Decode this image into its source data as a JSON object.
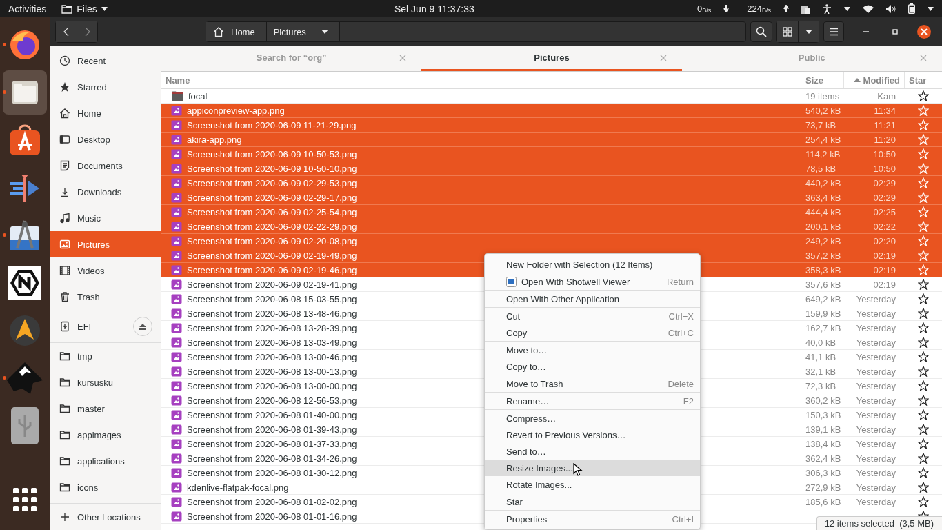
{
  "top_bar": {
    "activities": "Activities",
    "app_menu": "Files",
    "clock": "Sel Jun 9  11:37:33",
    "net_down": "0$_{B/s}$",
    "net_up": "224$_{B/s}$"
  },
  "dock": [
    {
      "kind": "browser",
      "running": true,
      "selected": false
    },
    {
      "kind": "files",
      "running": true,
      "selected": true
    },
    {
      "kind": "store",
      "running": false,
      "selected": false
    },
    {
      "kind": "video",
      "running": false,
      "selected": false
    },
    {
      "kind": "compass",
      "running": true,
      "selected": false
    },
    {
      "kind": "hexagon",
      "running": false,
      "selected": false
    },
    {
      "kind": "triangle",
      "running": false,
      "selected": false
    },
    {
      "kind": "ink",
      "running": true,
      "selected": false
    },
    {
      "kind": "usb",
      "running": false,
      "selected": false
    },
    {
      "kind": "grid",
      "running": false,
      "selected": false
    }
  ],
  "header": {
    "path": [
      {
        "label": "Home",
        "kind": "home"
      },
      {
        "label": "Pictures",
        "kind": "current"
      }
    ]
  },
  "sidebar": {
    "sections": [
      {
        "items": [
          {
            "label": "Recent",
            "kind": "recent",
            "selected": false
          },
          {
            "label": "Starred",
            "kind": "starred",
            "selected": false
          },
          {
            "label": "Home",
            "kind": "home",
            "selected": false
          },
          {
            "label": "Desktop",
            "kind": "desktop",
            "selected": false
          },
          {
            "label": "Documents",
            "kind": "documents",
            "selected": false
          },
          {
            "label": "Downloads",
            "kind": "downloads",
            "selected": false
          },
          {
            "label": "Music",
            "kind": "music",
            "selected": false
          },
          {
            "label": "Pictures",
            "kind": "pictures",
            "selected": true
          },
          {
            "label": "Videos",
            "kind": "videos",
            "selected": false
          },
          {
            "label": "Trash",
            "kind": "trash",
            "selected": false
          }
        ]
      },
      {
        "items": [
          {
            "label": "EFI",
            "kind": "drive",
            "selected": false
          }
        ]
      },
      {
        "items": [
          {
            "label": "tmp",
            "kind": "folder",
            "selected": false
          },
          {
            "label": "kursusku",
            "kind": "folder",
            "selected": false
          },
          {
            "label": "master",
            "kind": "folder",
            "selected": false
          },
          {
            "label": "appimages",
            "kind": "folder",
            "selected": false
          },
          {
            "label": "applications",
            "kind": "folder",
            "selected": false
          },
          {
            "label": "icons",
            "kind": "folder",
            "selected": false
          }
        ]
      },
      {
        "items": [
          {
            "label": "Other Locations",
            "kind": "other",
            "selected": false
          }
        ]
      }
    ]
  },
  "tabs": [
    {
      "label": "Search for “org”",
      "selected": false
    },
    {
      "label": "Pictures",
      "selected": true
    },
    {
      "label": "Public",
      "selected": false
    }
  ],
  "table": {
    "columns": [
      "Name",
      "Size",
      "Modified",
      "Star"
    ],
    "rows": [
      {
        "kind": "folder",
        "name": "focal",
        "size": "19 items",
        "modified": "Kam",
        "selected": false,
        "starred": false
      },
      {
        "kind": "image",
        "name": "appiconpreview-app.png",
        "size": "540,2 kB",
        "modified": "11:34",
        "selected": true,
        "starred": false
      },
      {
        "kind": "image",
        "name": "Screenshot from 2020-06-09 11-21-29.png",
        "size": "73,7 kB",
        "modified": "11:21",
        "selected": true,
        "starred": false
      },
      {
        "kind": "image",
        "name": "akira-app.png",
        "size": "254,4 kB",
        "modified": "11:20",
        "selected": true,
        "starred": false
      },
      {
        "kind": "image",
        "name": "Screenshot from 2020-06-09 10-50-53.png",
        "size": "114,2 kB",
        "modified": "10:50",
        "selected": true,
        "starred": false
      },
      {
        "kind": "image",
        "name": "Screenshot from 2020-06-09 10-50-10.png",
        "size": "78,5 kB",
        "modified": "10:50",
        "selected": true,
        "starred": false
      },
      {
        "kind": "image",
        "name": "Screenshot from 2020-06-09 02-29-53.png",
        "size": "440,2 kB",
        "modified": "02:29",
        "selected": true,
        "starred": false
      },
      {
        "kind": "image",
        "name": "Screenshot from 2020-06-09 02-29-17.png",
        "size": "363,4 kB",
        "modified": "02:29",
        "selected": true,
        "starred": false
      },
      {
        "kind": "image",
        "name": "Screenshot from 2020-06-09 02-25-54.png",
        "size": "444,4 kB",
        "modified": "02:25",
        "selected": true,
        "starred": false
      },
      {
        "kind": "image",
        "name": "Screenshot from 2020-06-09 02-22-29.png",
        "size": "200,1 kB",
        "modified": "02:22",
        "selected": true,
        "starred": false
      },
      {
        "kind": "image",
        "name": "Screenshot from 2020-06-09 02-20-08.png",
        "size": "249,2 kB",
        "modified": "02:20",
        "selected": true,
        "starred": false
      },
      {
        "kind": "image",
        "name": "Screenshot from 2020-06-09 02-19-49.png",
        "size": "357,2 kB",
        "modified": "02:19",
        "selected": true,
        "starred": false
      },
      {
        "kind": "image",
        "name": "Screenshot from 2020-06-09 02-19-46.png",
        "size": "358,3 kB",
        "modified": "02:19",
        "selected": true,
        "starred": false
      },
      {
        "kind": "image",
        "name": "Screenshot from 2020-06-09 02-19-41.png",
        "size": "357,6 kB",
        "modified": "02:19",
        "selected": false,
        "starred": false
      },
      {
        "kind": "image",
        "name": "Screenshot from 2020-06-08 15-03-55.png",
        "size": "649,2 kB",
        "modified": "Yesterday",
        "selected": false,
        "starred": false
      },
      {
        "kind": "image",
        "name": "Screenshot from 2020-06-08 13-48-46.png",
        "size": "159,9 kB",
        "modified": "Yesterday",
        "selected": false,
        "starred": false
      },
      {
        "kind": "image",
        "name": "Screenshot from 2020-06-08 13-28-39.png",
        "size": "162,7 kB",
        "modified": "Yesterday",
        "selected": false,
        "starred": false
      },
      {
        "kind": "image",
        "name": "Screenshot from 2020-06-08 13-03-49.png",
        "size": "40,0 kB",
        "modified": "Yesterday",
        "selected": false,
        "starred": false
      },
      {
        "kind": "image",
        "name": "Screenshot from 2020-06-08 13-00-46.png",
        "size": "41,1 kB",
        "modified": "Yesterday",
        "selected": false,
        "starred": false
      },
      {
        "kind": "image",
        "name": "Screenshot from 2020-06-08 13-00-13.png",
        "size": "32,1 kB",
        "modified": "Yesterday",
        "selected": false,
        "starred": false
      },
      {
        "kind": "image",
        "name": "Screenshot from 2020-06-08 13-00-00.png",
        "size": "72,3 kB",
        "modified": "Yesterday",
        "selected": false,
        "starred": false
      },
      {
        "kind": "image",
        "name": "Screenshot from 2020-06-08 12-56-53.png",
        "size": "360,2 kB",
        "modified": "Yesterday",
        "selected": false,
        "starred": false
      },
      {
        "kind": "image",
        "name": "Screenshot from 2020-06-08 01-40-00.png",
        "size": "150,3 kB",
        "modified": "Yesterday",
        "selected": false,
        "starred": false
      },
      {
        "kind": "image",
        "name": "Screenshot from 2020-06-08 01-39-43.png",
        "size": "139,1 kB",
        "modified": "Yesterday",
        "selected": false,
        "starred": false
      },
      {
        "kind": "image",
        "name": "Screenshot from 2020-06-08 01-37-33.png",
        "size": "138,4 kB",
        "modified": "Yesterday",
        "selected": false,
        "starred": false
      },
      {
        "kind": "image",
        "name": "Screenshot from 2020-06-08 01-34-26.png",
        "size": "362,4 kB",
        "modified": "Yesterday",
        "selected": false,
        "starred": false
      },
      {
        "kind": "image",
        "name": "Screenshot from 2020-06-08 01-30-12.png",
        "size": "306,3 kB",
        "modified": "Yesterday",
        "selected": false,
        "starred": false
      },
      {
        "kind": "image",
        "name": "kdenlive-flatpak-focal.png",
        "size": "272,9 kB",
        "modified": "Yesterday",
        "selected": false,
        "starred": false
      },
      {
        "kind": "image",
        "name": "Screenshot from 2020-06-08 01-02-02.png",
        "size": "185,6 kB",
        "modified": "Yesterday",
        "selected": false,
        "starred": false
      },
      {
        "kind": "image",
        "name": "Screenshot from 2020-06-08 01-01-16.png",
        "selected": false,
        "starred": false
      }
    ]
  },
  "context_menu": {
    "groups": [
      [
        {
          "label": "New Folder with Selection (12 Items)",
          "highlighted": false
        }
      ],
      [
        {
          "label": "Open With Shotwell Viewer",
          "shortcut": "Return",
          "kind": "app",
          "highlighted": false
        }
      ],
      [
        {
          "label": "Open With Other Application",
          "highlighted": false
        }
      ],
      [
        {
          "label": "Cut",
          "shortcut": "Ctrl+X",
          "highlighted": false
        },
        {
          "label": "Copy",
          "shortcut": "Ctrl+C",
          "highlighted": false
        }
      ],
      [
        {
          "label": "Move to…",
          "highlighted": false
        },
        {
          "label": "Copy to…",
          "highlighted": false
        }
      ],
      [
        {
          "label": "Move to Trash",
          "shortcut": "Delete",
          "highlighted": false
        }
      ],
      [
        {
          "label": "Rename…",
          "shortcut": "F2",
          "highlighted": false
        }
      ],
      [
        {
          "label": "Compress…",
          "highlighted": false
        },
        {
          "label": "Revert to Previous Versions…",
          "highlighted": false
        },
        {
          "label": "Send to…",
          "highlighted": false
        },
        {
          "label": "Resize Images...",
          "highlighted": true
        },
        {
          "label": "Rotate Images...",
          "highlighted": false
        }
      ],
      [
        {
          "label": "Star",
          "highlighted": false
        }
      ],
      [
        {
          "label": "Properties",
          "shortcut": "Ctrl+I",
          "highlighted": false
        }
      ]
    ]
  },
  "status": "12 items selected  (3,5 MB)"
}
